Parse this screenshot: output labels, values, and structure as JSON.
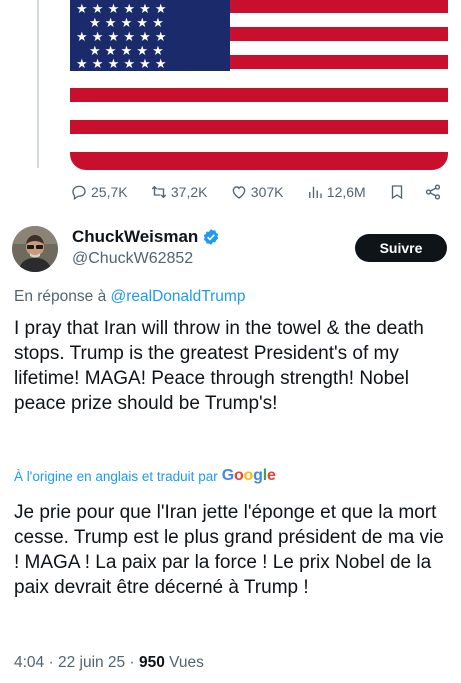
{
  "previous_tweet": {
    "media": {
      "kind": "image",
      "subject": "us-flag"
    },
    "actions": {
      "replies": "25,7K",
      "reposts": "37,2K",
      "likes": "307K",
      "views": "12,6M"
    }
  },
  "tweet": {
    "author": {
      "display_name": "ChuckWeisman",
      "handle": "@ChuckW62852",
      "verified": true
    },
    "follow_label": "Suivre",
    "reply_prefix": "En réponse à",
    "reply_mention": "@realDonaldTrump",
    "text": "I pray that Iran will throw in the towel & the death stops. Trump is the greatest President's of my lifetime! MAGA! Peace through strength! Nobel peace prize should be Trump's!",
    "translated_label": "À l'origine en anglais et traduit par",
    "translator": "Google",
    "translation": "Je prie pour que l'Iran jette l'éponge et que la mort cesse. Trump est le plus grand président de ma vie ! MAGA ! La paix par la force ! Le prix Nobel de la paix devrait être décerné à Trump !",
    "time": "4:04",
    "date": "22 juin 25",
    "views_count": "950",
    "views_label": "Vues"
  },
  "colors": {
    "accent": "#1d9bf0",
    "verified": "#1d9bf0",
    "muted_text": "#536471",
    "flag_red": "#c8102e",
    "flag_blue": "#1b2a6b"
  },
  "icons": [
    "reply-icon",
    "repost-icon",
    "like-icon",
    "views-icon",
    "bookmark-icon",
    "share-icon",
    "verified-badge-icon",
    "google-logo"
  ]
}
